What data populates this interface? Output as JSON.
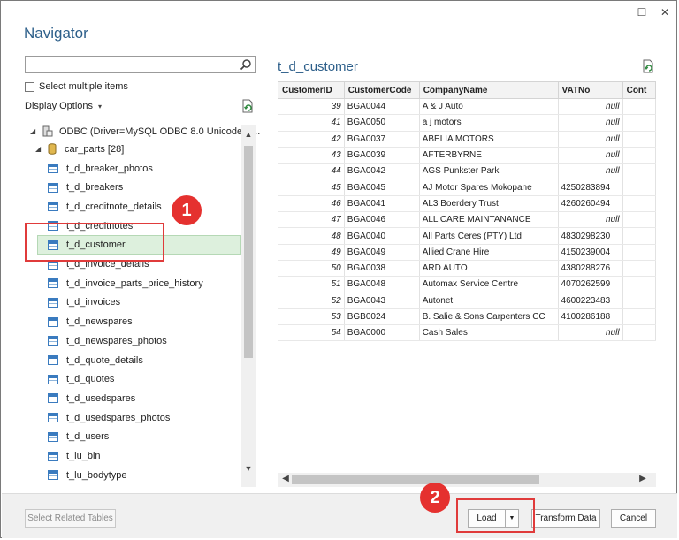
{
  "window": {
    "title": "Navigator",
    "maximize_glyph": "☐",
    "close_glyph": "✕"
  },
  "search": {
    "placeholder": "",
    "value": "",
    "icon": "search-icon"
  },
  "select_multiple_label": "Select multiple items",
  "display_options_label": "Display Options",
  "tree": {
    "root_label": "ODBC (Driver=MySQL ODBC 8.0 Unicode D...",
    "db_label": "car_parts [28]",
    "tables": [
      "t_d_breaker_photos",
      "t_d_breakers",
      "t_d_creditnote_details",
      "t_d_creditnotes",
      "t_d_customer",
      "t_d_invoice_details",
      "t_d_invoice_parts_price_history",
      "t_d_invoices",
      "t_d_newspares",
      "t_d_newspares_photos",
      "t_d_quote_details",
      "t_d_quotes",
      "t_d_usedspares",
      "t_d_usedspares_photos",
      "t_d_users",
      "t_lu_bin",
      "t_lu_bodytype"
    ],
    "selected": "t_d_customer"
  },
  "preview": {
    "title": "t_d_customer",
    "columns": [
      "CustomerID",
      "CustomerCode",
      "CompanyName",
      "VATNo",
      "Cont"
    ],
    "rows": [
      [
        "39",
        "BGA0044",
        "A & J Auto",
        "null"
      ],
      [
        "41",
        "BGA0050",
        "a j motors",
        "null"
      ],
      [
        "42",
        "BGA0037",
        "ABELIA MOTORS",
        "null"
      ],
      [
        "43",
        "BGA0039",
        "AFTERBYRNE",
        "null"
      ],
      [
        "44",
        "BGA0042",
        "AGS Punkster Park",
        "null"
      ],
      [
        "45",
        "BGA0045",
        "AJ Motor Spares Mokopane",
        "4250283894"
      ],
      [
        "46",
        "BGA0041",
        "AL3 Boerdery Trust",
        "4260260494"
      ],
      [
        "47",
        "BGA0046",
        "ALL CARE MAINTANANCE",
        "null"
      ],
      [
        "48",
        "BGA0040",
        "All Parts Ceres (PTY) Ltd",
        "4830298230"
      ],
      [
        "49",
        "BGA0049",
        "Allied Crane Hire",
        "4150239004"
      ],
      [
        "50",
        "BGA0038",
        "ARD AUTO",
        "4380288276"
      ],
      [
        "51",
        "BGA0048",
        "Automax Service Centre",
        "4070262599"
      ],
      [
        "52",
        "BGA0043",
        "Autonet",
        "4600223483"
      ],
      [
        "53",
        "BGB0024",
        "B. Salie & Sons Carpenters CC",
        "4100286188"
      ],
      [
        "54",
        "BGA0000",
        "Cash Sales",
        "null"
      ]
    ]
  },
  "footer": {
    "select_related": "Select Related Tables",
    "load": "Load",
    "transform": "Transform Data",
    "cancel": "Cancel"
  },
  "annotations": {
    "badge1": "1",
    "badge2": "2",
    "color": "#e5312f"
  }
}
